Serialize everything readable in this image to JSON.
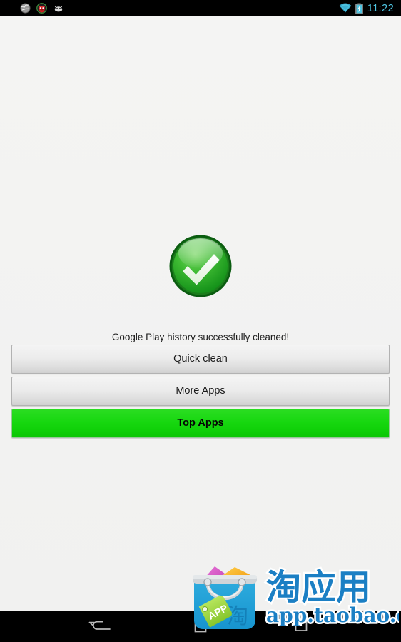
{
  "status_bar": {
    "notification_icons": [
      {
        "name": "globe-icon",
        "label": "Browser notification"
      },
      {
        "name": "alert-face-icon",
        "label": "App notification"
      },
      {
        "name": "android-head-icon",
        "label": "Android system notification"
      }
    ],
    "wifi_icon": "wifi-icon",
    "battery_icon": "battery-charging-icon",
    "time": "11:22",
    "time_color": "#4ec3e0",
    "background_color": "#000000"
  },
  "main": {
    "success_icon": "green-check-circle-icon",
    "status_message": "Google Play history successfully cleaned!",
    "background_color": "#f2f2f2",
    "buttons": [
      {
        "label": "Quick clean",
        "style": "grey",
        "name": "quick-clean-button"
      },
      {
        "label": "More Apps",
        "style": "grey",
        "name": "more-apps-button"
      },
      {
        "label": "Top Apps",
        "style": "green",
        "name": "top-apps-button",
        "color": "#13d70c"
      }
    ]
  },
  "watermark": {
    "bag_icon": "taobao-app-bag-icon",
    "tag_label": "APP",
    "bag_chinese_glyph": "淘",
    "brand_chinese": "淘应用",
    "brand_url": "app.taobao.com",
    "brand_color": "#1b7fc4"
  },
  "nav_bar": {
    "buttons": [
      {
        "name": "back-button",
        "icon": "back-arrow-icon"
      },
      {
        "name": "home-button",
        "icon": "home-square-icon"
      },
      {
        "name": "recents-button",
        "icon": "recents-icon"
      }
    ],
    "background_color": "#000000"
  }
}
